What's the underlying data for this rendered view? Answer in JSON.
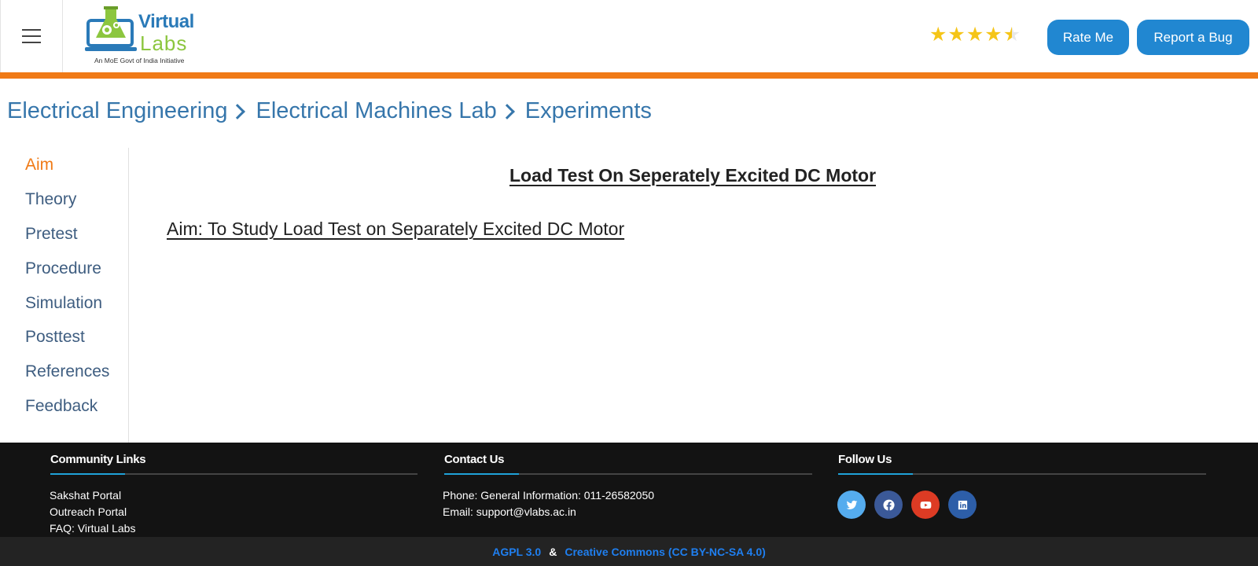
{
  "header": {
    "logo": {
      "word1": "Virtual",
      "word2": "Labs",
      "tagline": "An MoE Govt of India Initiative"
    },
    "rating": {
      "value": 4.5,
      "max": 5
    },
    "rate_button": "Rate Me",
    "bug_button": "Report a Bug"
  },
  "breadcrumb": [
    "Electrical Engineering",
    "Electrical Machines Lab",
    "Experiments"
  ],
  "sidebar": {
    "items": [
      {
        "label": "Aim",
        "active": true
      },
      {
        "label": "Theory",
        "active": false
      },
      {
        "label": "Pretest",
        "active": false
      },
      {
        "label": "Procedure",
        "active": false
      },
      {
        "label": "Simulation",
        "active": false
      },
      {
        "label": "Posttest",
        "active": false
      },
      {
        "label": "References",
        "active": false
      },
      {
        "label": "Feedback",
        "active": false
      }
    ]
  },
  "main": {
    "title": "Load Test On Seperately Excited DC Motor",
    "aim": "Aim: To Study Load Test on Separately Excited DC Motor"
  },
  "footer": {
    "community": {
      "heading": "Community Links",
      "links": [
        "Sakshat Portal",
        "Outreach Portal",
        "FAQ: Virtual Labs"
      ]
    },
    "contact": {
      "heading": "Contact Us",
      "phone": "Phone: General Information: 011-26582050",
      "email": "Email: support@vlabs.ac.in"
    },
    "follow": {
      "heading": "Follow Us",
      "socials": [
        {
          "icon": "twitter-icon",
          "color": "#55acee"
        },
        {
          "icon": "facebook-icon",
          "color": "#3b5998"
        },
        {
          "icon": "youtube-icon",
          "color": "#dd3b24"
        },
        {
          "icon": "linkedin-icon",
          "color": "#2d5ea8"
        }
      ]
    },
    "license": {
      "agpl": "AGPL 3.0",
      "separator": "&",
      "cc": "Creative Commons (CC BY-NC-SA 4.0)"
    }
  },
  "colors": {
    "accent_orange": "#f07a16",
    "button_blue": "#2187d1",
    "link_blue": "#3676ab",
    "footer_bg": "#131313"
  }
}
